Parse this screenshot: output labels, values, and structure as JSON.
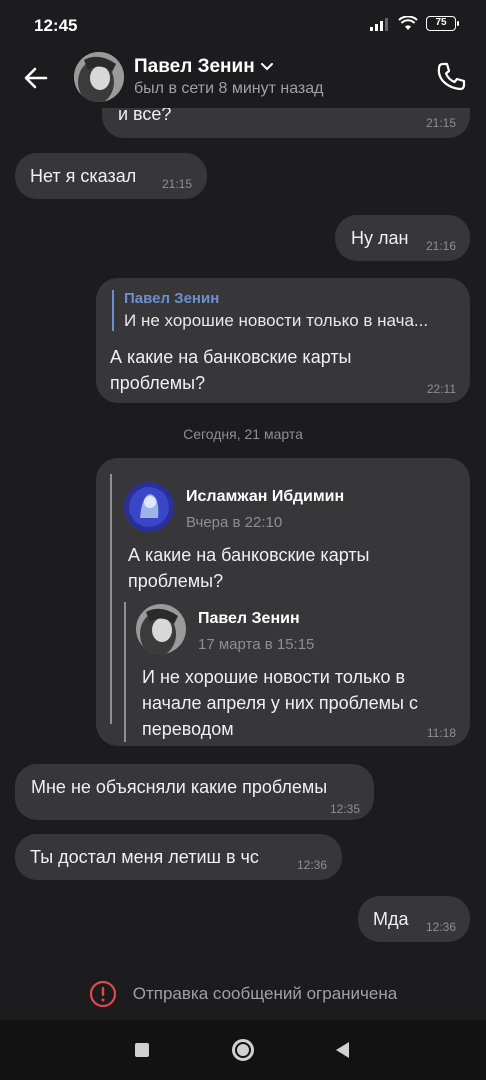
{
  "status_bar": {
    "time": "12:45",
    "battery": "75"
  },
  "header": {
    "name": "Павел Зенин",
    "status": "был в сети 8 минут назад"
  },
  "messages": [
    {
      "side": "out",
      "text": "и все?",
      "time": "21:15"
    },
    {
      "side": "in",
      "text": "Нет я сказал",
      "time": "21:15"
    },
    {
      "side": "out",
      "text": "Ну лан",
      "time": "21:16"
    },
    {
      "side": "out",
      "reply_to": {
        "name": "Павел Зенин",
        "text": "И не хорошие новости только в нача..."
      },
      "text_line1": "А какие на банковские карты",
      "text_line2": "проблемы?",
      "time": "22:11"
    }
  ],
  "date_separator": "Сегодня, 21 марта",
  "forwarded_message": {
    "time": "11:18",
    "outer": {
      "name": "Исламжан Ибдимин",
      "date": "Вчера в 22:10",
      "text_line1": "А какие на банковские карты",
      "text_line2": "проблемы?"
    },
    "inner": {
      "name": "Павел Зенин",
      "date": "17 марта в 15:15",
      "text_line1": "И не хорошие новости только в",
      "text_line2": "начале апреля у них проблемы с",
      "text_line3": "переводом"
    }
  },
  "messages_today": [
    {
      "side": "in",
      "text": "Мне не объясняли какие проблемы",
      "time": "12:35"
    },
    {
      "side": "in",
      "text": "Ты достал меня летиш в чс",
      "time": "12:36"
    },
    {
      "side": "out",
      "text": "Мда",
      "time": "12:36"
    }
  ],
  "restricted_notice": "Отправка сообщений ограничена",
  "colors": {
    "background": "#1c1c1e",
    "bubble": "#37373a",
    "accent": "#6d8fce",
    "warning": "#e0494f"
  }
}
